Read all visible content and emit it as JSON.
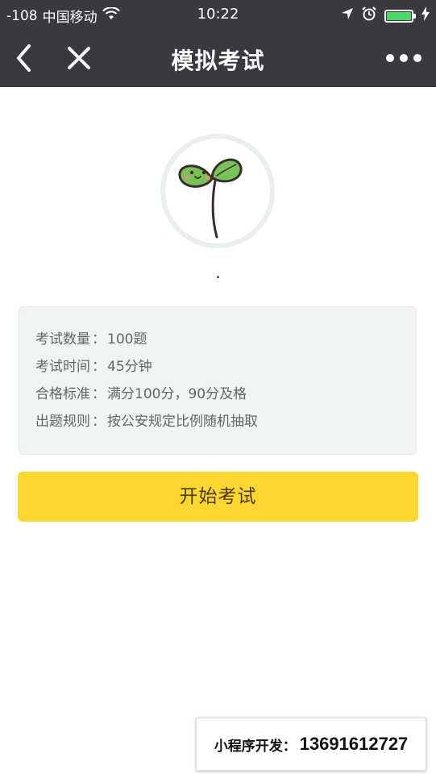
{
  "status_bar": {
    "signal": "-108",
    "carrier": "中国移动",
    "time": "10:22",
    "icons": [
      "wifi-icon",
      "location-arrow-icon",
      "alarm-icon",
      "battery-icon",
      "charging-icon"
    ],
    "battery_level": 1.0,
    "battery_color": "#4cd964"
  },
  "nav": {
    "title": "模拟考试",
    "icons": [
      "back-icon",
      "close-icon",
      "more-icon"
    ]
  },
  "profile": {
    "name": "."
  },
  "exam_info": {
    "count_label": "考试数量",
    "count_value": "100题",
    "time_label": "考试时间",
    "time_value": "45分钟",
    "pass_label": "合格标准",
    "pass_value": "满分100分，90分及格",
    "rule_label": "出题规则",
    "rule_value": "按公安规定比例随机抽取",
    "separator": "："
  },
  "actions": {
    "start_label": "开始考试"
  },
  "badge": {
    "label": "小程序开发：",
    "phone": "13691612727"
  },
  "colors": {
    "nav_background": "#393a3f",
    "button_yellow": "#fdd632",
    "card_background": "#f0f4f4",
    "sprout_green": "#78c257"
  }
}
